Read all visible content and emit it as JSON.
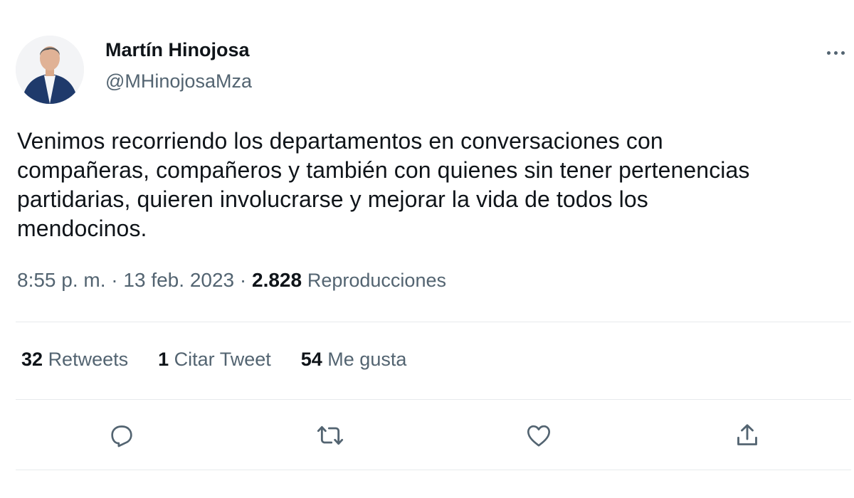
{
  "author": {
    "name": "Martín Hinojosa",
    "handle": "@MHinojosaMza"
  },
  "tweet": {
    "text_lines": [
      "Venimos recorriendo los departamentos en conversaciones con",
      "compañeras, compañeros y también con quienes sin tener pertenencias",
      "partidarias, quieren involucrarse y mejorar la vida de todos los",
      "mendocinos."
    ],
    "time": "8:55 p. m.",
    "date": "13 feb. 2023",
    "separator": "·",
    "views_count": "2.828",
    "views_label": "Reproducciones"
  },
  "stats": {
    "retweets_count": "32",
    "retweets_label": "Retweets",
    "quotes_count": "1",
    "quotes_label": "Citar Tweet",
    "likes_count": "54",
    "likes_label": "Me gusta"
  },
  "icons": {
    "more": "more-horizontal-icon",
    "reply": "reply-icon",
    "retweet": "retweet-icon",
    "like": "heart-icon",
    "share": "share-icon"
  },
  "colors": {
    "primary_text": "#0f1419",
    "secondary_text": "#536471",
    "divider": "#e7eaec"
  }
}
